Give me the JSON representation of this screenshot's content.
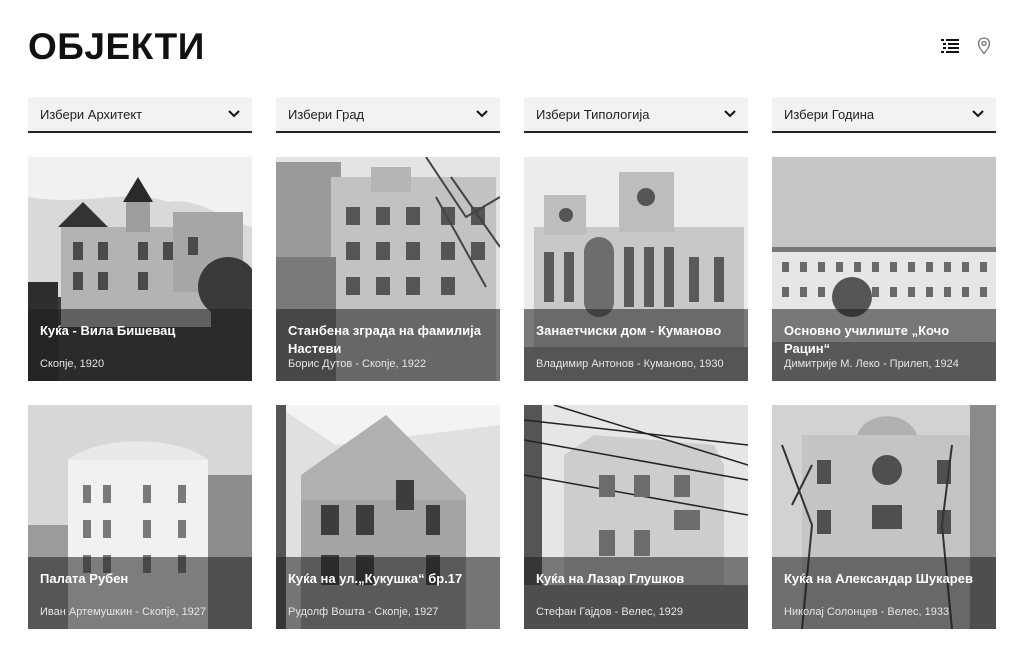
{
  "header": {
    "title": "ОБЈЕКТИ",
    "list_view_icon": "list-icon",
    "map_view_icon": "map-pin-icon"
  },
  "filters": [
    {
      "label": "Избери Архитект"
    },
    {
      "label": "Избери Град"
    },
    {
      "label": "Избери Типологија"
    },
    {
      "label": "Избери Година"
    }
  ],
  "cards": [
    {
      "title": "Куќа - Вила Бишевац",
      "meta": "Скопје, 1920"
    },
    {
      "title": "Станбена зграда на фамилија Настеви",
      "meta": "Борис Дутов - Скопје, 1922"
    },
    {
      "title": "Занаетчиски дом - Куманово",
      "meta": "Владимир Антонов - Куманово, 1930"
    },
    {
      "title": "Основно училиште „Кочо Рацин“",
      "meta": "Димитрије М. Леко - Прилеп, 1924"
    },
    {
      "title": "Палата Рубен",
      "meta": "Иван Артемушкин - Скопје, 1927"
    },
    {
      "title": "Куќа на ул.„Кукушка“ бр.17",
      "meta": "Рудолф Вошта - Скопје, 1927"
    },
    {
      "title": "Куќа на Лазар Глушков",
      "meta": "Стефан Гајдов - Велес, 1929"
    },
    {
      "title": "Куќа на Александар Шукарев",
      "meta": "Николај Солонцев - Велес, 1933"
    }
  ]
}
